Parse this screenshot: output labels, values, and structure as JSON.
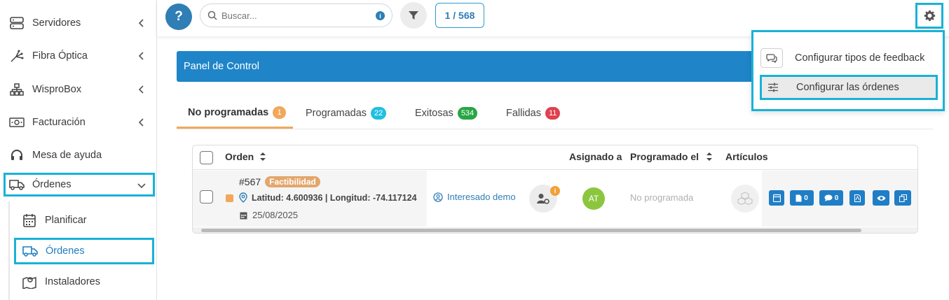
{
  "sidebar": {
    "items": [
      {
        "label": "Servidores"
      },
      {
        "label": "Fibra Óptica"
      },
      {
        "label": "WisproBox"
      },
      {
        "label": "Facturación"
      },
      {
        "label": "Mesa de ayuda"
      },
      {
        "label": "Órdenes"
      }
    ],
    "submenu": [
      {
        "label": "Planificar"
      },
      {
        "label": "Órdenes"
      },
      {
        "label": "Instaladores"
      }
    ]
  },
  "topbar": {
    "help_label": "?",
    "search_placeholder": "Buscar...",
    "info_label": "i",
    "counter": "1 / 568"
  },
  "dropdown": {
    "items": [
      {
        "label": "Configurar tipos de feedback"
      },
      {
        "label": "Configurar las órdenes"
      }
    ]
  },
  "panel": {
    "title": "Panel de Control"
  },
  "tabs": [
    {
      "label": "No programadas",
      "count": "1",
      "color": "#f0a85b"
    },
    {
      "label": "Programadas",
      "count": "22",
      "color": "#1ec0e0"
    },
    {
      "label": "Exitosas",
      "count": "534",
      "color": "#27a644"
    },
    {
      "label": "Fallidas",
      "count": "11",
      "color": "#e0404f"
    }
  ],
  "table": {
    "headers": {
      "orden": "Orden",
      "asignado": "Asignado a",
      "programado": "Programado el",
      "articulos": "Artículos"
    },
    "row": {
      "id": "#567",
      "status": "Factibilidad",
      "coords": "Latitud: 4.600936 | Longitud: -74.117124",
      "date": "25/08/2025",
      "client": "Interesado demo",
      "user_badge": "i",
      "assignee": "AT",
      "scheduled": "No programada",
      "attachments_count": "0",
      "comments_count": "0"
    }
  },
  "colors": {
    "accent": "#1f85c8",
    "highlight": "#19b2d6",
    "status_tag": "#e3a66c",
    "avatar": "#8cc63f"
  }
}
